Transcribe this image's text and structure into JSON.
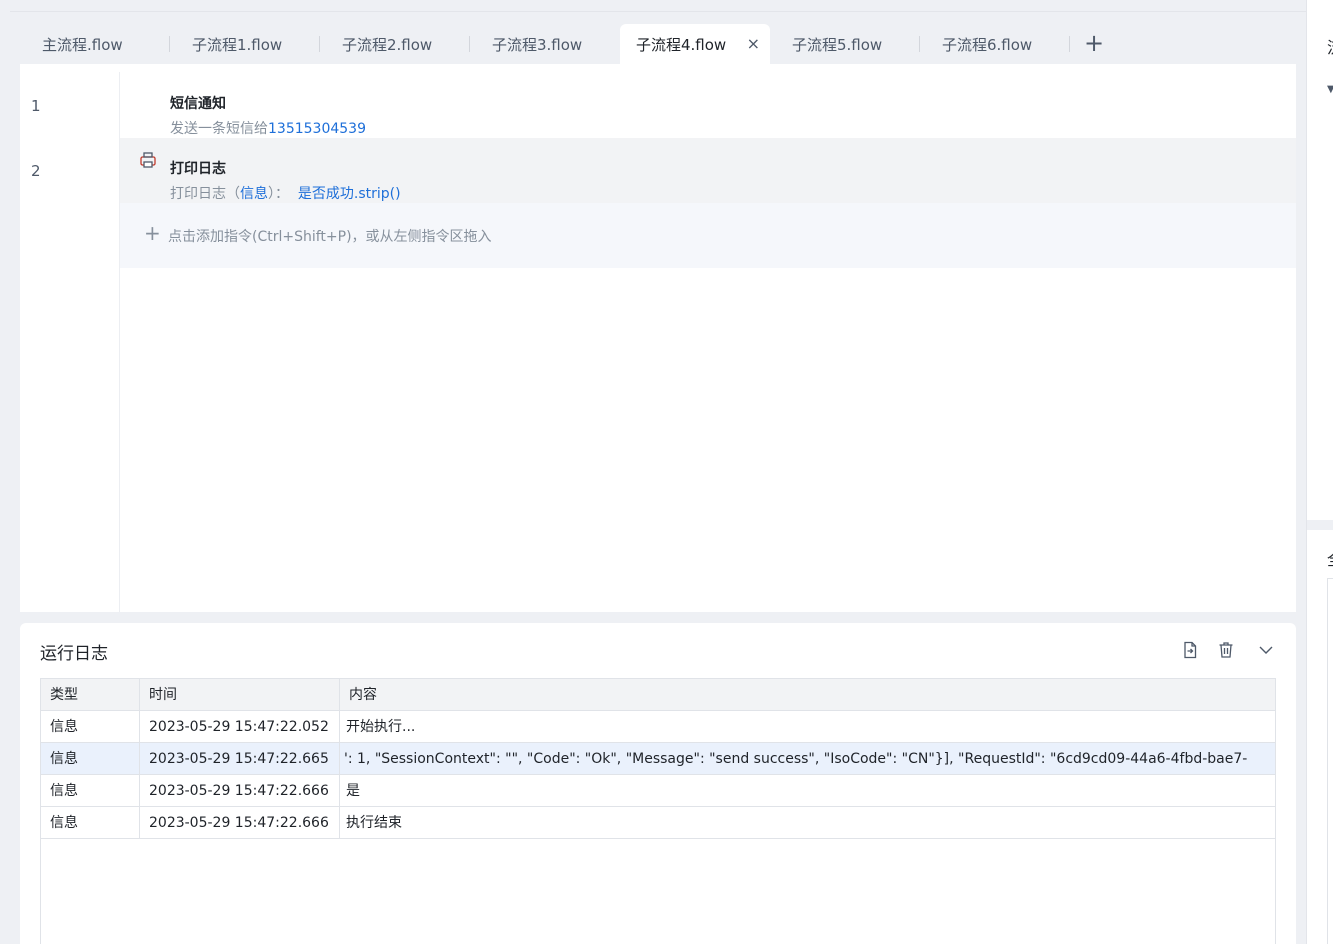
{
  "tabs": [
    {
      "label": "主流程.flow",
      "active": false
    },
    {
      "label": "子流程1.flow",
      "active": false
    },
    {
      "label": "子流程2.flow",
      "active": false
    },
    {
      "label": "子流程3.flow",
      "active": false
    },
    {
      "label": "子流程4.flow",
      "active": true
    },
    {
      "label": "子流程5.flow",
      "active": false
    },
    {
      "label": "子流程6.flow",
      "active": false
    }
  ],
  "tab_close_glyph": "×",
  "tab_add_glyph": "+",
  "editor": {
    "steps": [
      {
        "line": "1",
        "title": "短信通知",
        "desc_prefix": "发送一条短信给",
        "desc_value": "13515304539",
        "icon": "none"
      },
      {
        "line": "2",
        "title": "打印日志",
        "desc_prefix": "打印日志（",
        "desc_keyword": "信息",
        "desc_mid": "）：",
        "desc_value": "是否成功.strip()",
        "icon": "printer-icon"
      }
    ],
    "add_plus": "+",
    "add_hint": "点击添加指令(Ctrl+Shift+P)，或从左侧指令区拖入"
  },
  "log": {
    "title": "运行日志",
    "columns": [
      "类型",
      "时间",
      "内容"
    ],
    "rows": [
      {
        "type": "信息",
        "time": "2023-05-29 15:47:22.052",
        "content": "开始执行..."
      },
      {
        "type": "信息",
        "time": "2023-05-29 15:47:22.665",
        "content": "': 1, \"SessionContext\": \"\", \"Code\": \"Ok\", \"Message\": \"send success\", \"IsoCode\": \"CN\"}], \"RequestId\": \"6cd9cd09-44a6-4fbd-bae7-"
      },
      {
        "type": "信息",
        "time": "2023-05-29 15:47:22.666",
        "content": "是"
      },
      {
        "type": "信息",
        "time": "2023-05-29 15:47:22.666",
        "content": "执行结束"
      }
    ]
  },
  "right_panel": {
    "glyph_top": "流",
    "glyph_mid": "全"
  }
}
